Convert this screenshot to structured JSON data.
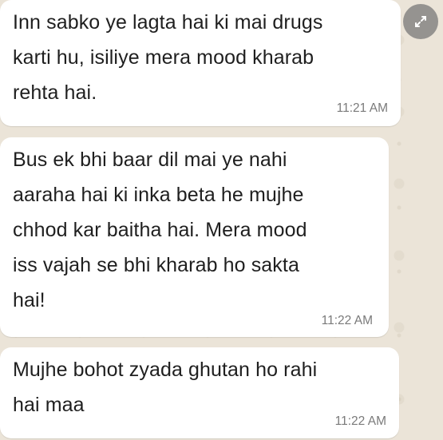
{
  "messages": [
    {
      "lines": [
        "Inn sabko ye lagta hai ki mai drugs",
        "karti hu, isiliye mera mood kharab",
        "rehta hai."
      ],
      "time": "11:21 AM"
    },
    {
      "lines": [
        "Bus ek bhi baar dil mai ye nahi",
        "aaraha hai ki inka beta he mujhe",
        "chhod kar baitha hai. Mera mood",
        "iss vajah se bhi kharab ho sakta",
        "hai!"
      ],
      "time": "11:22 AM"
    },
    {
      "lines": [
        "Mujhe bohot zyada ghutan ho rahi",
        "hai maa"
      ],
      "time": "11:22 AM"
    }
  ],
  "icons": {
    "expand": "expand-arrows-icon"
  },
  "colors": {
    "bubble": "#ffffff",
    "timestamp": "#7a7a7a",
    "wallpaper": "#ebe4d8"
  }
}
